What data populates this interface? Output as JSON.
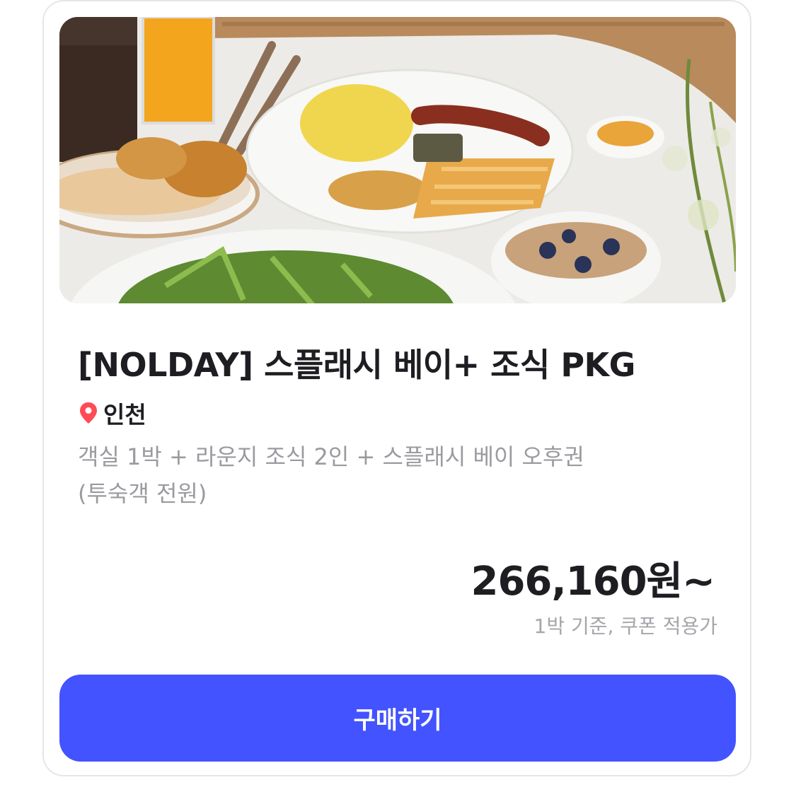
{
  "product": {
    "title": "[NOLDAY] 스플래시 베이+ 조식 PKG",
    "location": "인천",
    "location_icon": "map-pin-icon",
    "description_line1": "객실 1박 + 라운지 조식 2인 + 스플래시 베이 오후권",
    "description_line2": "(투숙객 전원)",
    "price": "266,160원~",
    "price_note": "1박 기준, 쿠폰 적용가"
  },
  "actions": {
    "buy_label": "구매하기"
  },
  "colors": {
    "accent": "#4353ff",
    "pin": "#ff4b55",
    "title_text": "#1d1d22",
    "muted_text": "#9a9aa0"
  }
}
